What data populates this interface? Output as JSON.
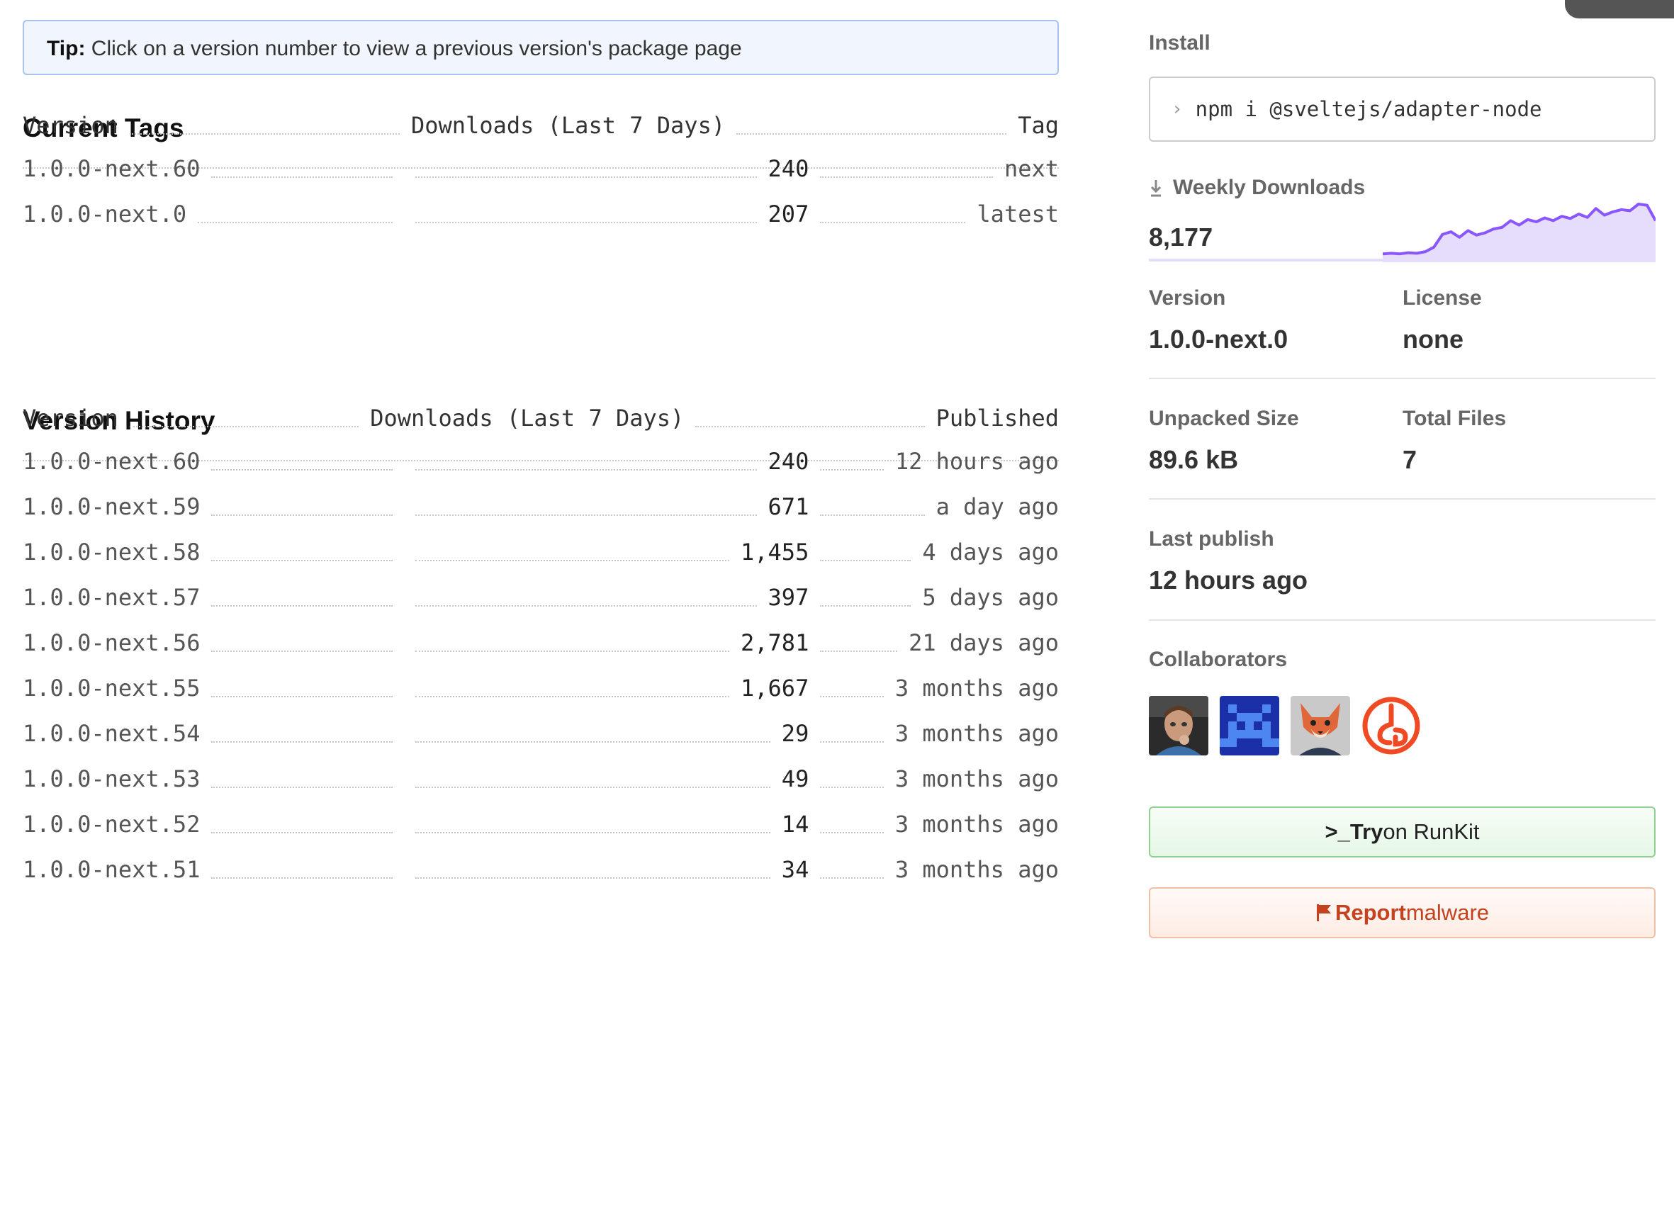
{
  "tip": {
    "prefix": "Tip:",
    "text": " Click on a version number to view a previous version's package page"
  },
  "current_tags": {
    "title": "Current Tags",
    "headers": {
      "version": "Version",
      "downloads": "Downloads (Last 7 Days)",
      "tag": "Tag"
    },
    "rows": [
      {
        "version": "1.0.0-next.60",
        "downloads": "240",
        "tag": "next"
      },
      {
        "version": "1.0.0-next.0",
        "downloads": "207",
        "tag": "latest"
      }
    ]
  },
  "version_history": {
    "title": "Version History",
    "headers": {
      "version": "Version",
      "downloads": "Downloads (Last 7 Days)",
      "published": "Published"
    },
    "rows": [
      {
        "version": "1.0.0-next.60",
        "downloads": "240",
        "published": "12 hours ago"
      },
      {
        "version": "1.0.0-next.59",
        "downloads": "671",
        "published": "a day ago"
      },
      {
        "version": "1.0.0-next.58",
        "downloads": "1,455",
        "published": "4 days ago"
      },
      {
        "version": "1.0.0-next.57",
        "downloads": "397",
        "published": "5 days ago"
      },
      {
        "version": "1.0.0-next.56",
        "downloads": "2,781",
        "published": "21 days ago"
      },
      {
        "version": "1.0.0-next.55",
        "downloads": "1,667",
        "published": "3 months ago"
      },
      {
        "version": "1.0.0-next.54",
        "downloads": "29",
        "published": "3 months ago"
      },
      {
        "version": "1.0.0-next.53",
        "downloads": "49",
        "published": "3 months ago"
      },
      {
        "version": "1.0.0-next.52",
        "downloads": "14",
        "published": "3 months ago"
      },
      {
        "version": "1.0.0-next.51",
        "downloads": "34",
        "published": "3 months ago"
      }
    ]
  },
  "sidebar": {
    "install": {
      "label": "Install",
      "command": "npm i @sveltejs/adapter-node",
      "prompt_icon": "chevron-right-icon"
    },
    "weekly_downloads": {
      "label": "Weekly Downloads",
      "icon": "download-icon",
      "value": "8,177",
      "sparkline": [
        0.1,
        0.11,
        0.1,
        0.12,
        0.11,
        0.14,
        0.22,
        0.45,
        0.5,
        0.4,
        0.52,
        0.44,
        0.48,
        0.55,
        0.58,
        0.7,
        0.62,
        0.72,
        0.68,
        0.75,
        0.7,
        0.78,
        0.74,
        0.82,
        0.76,
        0.92,
        0.8,
        0.86,
        0.9,
        0.88,
        1.0,
        0.98,
        0.7
      ],
      "line_color": "#8956ff",
      "fill_color": "#e6dcfb"
    },
    "version": {
      "label": "Version",
      "value": "1.0.0-next.0"
    },
    "license": {
      "label": "License",
      "value": "none"
    },
    "unpacked_size": {
      "label": "Unpacked Size",
      "value": "89.6 kB"
    },
    "total_files": {
      "label": "Total Files",
      "value": "7"
    },
    "last_publish": {
      "label": "Last publish",
      "value": "12 hours ago"
    },
    "collaborators": {
      "label": "Collaborators",
      "avatars": [
        "avatar-photo-person",
        "avatar-blue-pixel-invader",
        "avatar-fox-cartoon",
        "avatar-orange-symbol"
      ]
    },
    "runkit_button": {
      "prefix": ">_",
      "strong": "Try",
      "rest": " on RunKit"
    },
    "report_button": {
      "icon": "flag-icon",
      "strong": "Report",
      "rest": " malware"
    }
  }
}
